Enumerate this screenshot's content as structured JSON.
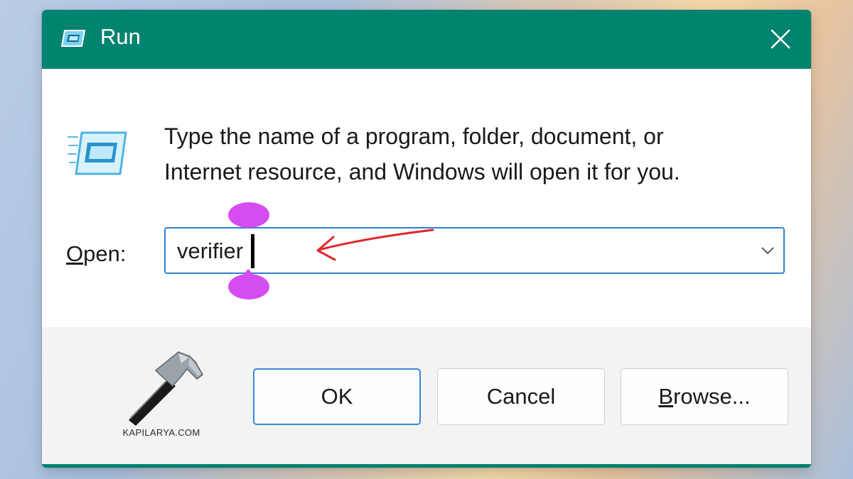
{
  "window": {
    "title": "Run",
    "title_icon": "run-icon",
    "close_icon": "close-icon",
    "titlebar_color": "#00836f"
  },
  "body": {
    "description_line1": "Type the name of a program, folder, document, or",
    "description_line2": "Internet resource, and Windows will open it for you.",
    "big_icon": "run-icon"
  },
  "open_field": {
    "label_mnemonic": "O",
    "label_rest": "pen:",
    "value": "verifier",
    "dropdown_icon": "chevron-down-icon",
    "accent": "#2f7fd0"
  },
  "annotation": {
    "arrow_color": "#e0262b",
    "handle_color": "#d54cf0"
  },
  "buttons": {
    "ok": "OK",
    "cancel": "Cancel",
    "browse_mnemonic": "B",
    "browse_rest": "rowse..."
  },
  "watermark": {
    "text": "KAPILARYA.COM",
    "icon": "hammer-icon"
  }
}
